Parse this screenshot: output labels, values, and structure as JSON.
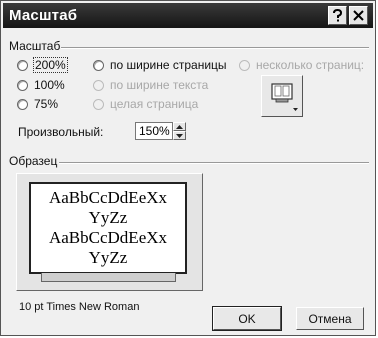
{
  "window": {
    "title": "Масштаб"
  },
  "zoom_group": {
    "label": "Масштаб",
    "options": [
      {
        "label": "200%",
        "selected": false,
        "disabled": false
      },
      {
        "label": "100%",
        "selected": false,
        "disabled": false
      },
      {
        "label": "75%",
        "selected": false,
        "disabled": false
      },
      {
        "label": "по ширине страницы",
        "selected": false,
        "disabled": false
      },
      {
        "label": "по ширине текста",
        "selected": false,
        "disabled": true
      },
      {
        "label": "целая страница",
        "selected": false,
        "disabled": true
      },
      {
        "label": "несколько страниц:",
        "selected": false,
        "disabled": true
      }
    ],
    "custom_label": "Произвольный:",
    "custom_value": "150%"
  },
  "preview": {
    "label": "Образец",
    "sample_text": "AaBbCcDdEeXx YyZz AaBbCcDdEeXx YyZz",
    "font_description": "10 pt Times New Roman"
  },
  "buttons": {
    "ok": "OK",
    "cancel": "Отмена"
  }
}
